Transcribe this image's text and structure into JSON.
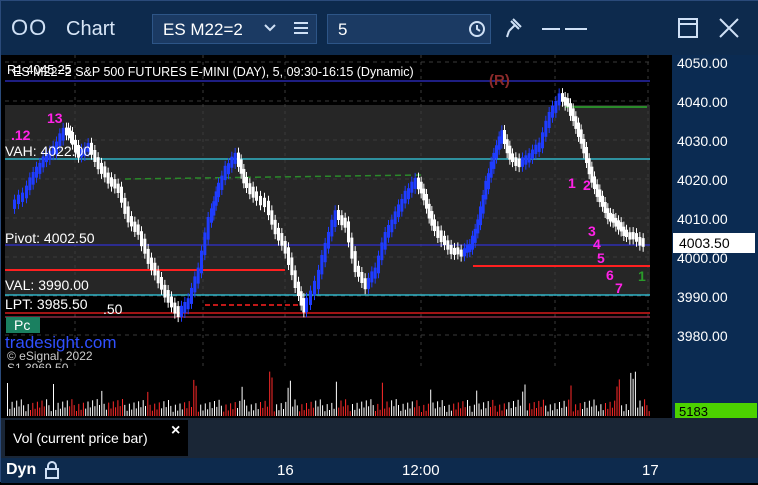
{
  "window": {
    "title_icon": "OO",
    "title": "Chart",
    "symbol": "ES M22=2",
    "interval": "5",
    "icons": [
      "chevron-down-icon",
      "menu-icon",
      "clock-icon",
      "pin-icon",
      "minimize-icon",
      "maximize-icon",
      "close-icon"
    ]
  },
  "chart": {
    "header": "ES M22=2   S&P 500 FUTURES E-MINI (DAY), 5, 09:30-16:15 (Dynamic)",
    "header_prefix": "R1 4045.25",
    "r_marker": "(R)",
    "labels": {
      "vah": "VAH: 4022.00",
      "pivot": "Pivot: 4002.50",
      "val": "VAL: 3990.00",
      "lpt": "LPT: 3985.50",
      "extra": ".50",
      "pc": "Pc",
      "brand": "tradesight.com",
      "copyright": "© eSignal, 2022",
      "s1": "S1  3969.50"
    },
    "markers_top": [
      ".12",
      "13"
    ],
    "magenta_counts": [
      "1",
      "2",
      "3",
      "4",
      "5",
      "6",
      "7"
    ],
    "green_end": "1",
    "yaxis": [
      "4050.00",
      "4040.00",
      "4030.00",
      "4020.00",
      "4010.00",
      "4000.00",
      "3990.00",
      "3980.00"
    ],
    "current_price": "4003.50",
    "xaxis": [
      "16",
      "12:00",
      "17"
    ],
    "colors": {
      "bull": "#1f3cff",
      "bear": "#ffffff",
      "accent_green": "#2a8a2a",
      "magenta": "#ff22e6",
      "cyan": "#33d0e6",
      "red": "#ff2020"
    }
  },
  "volume": {
    "value": "5183",
    "label": "Vol (current price bar)",
    "close": "×"
  },
  "footer": {
    "dyn": "Dyn"
  }
}
